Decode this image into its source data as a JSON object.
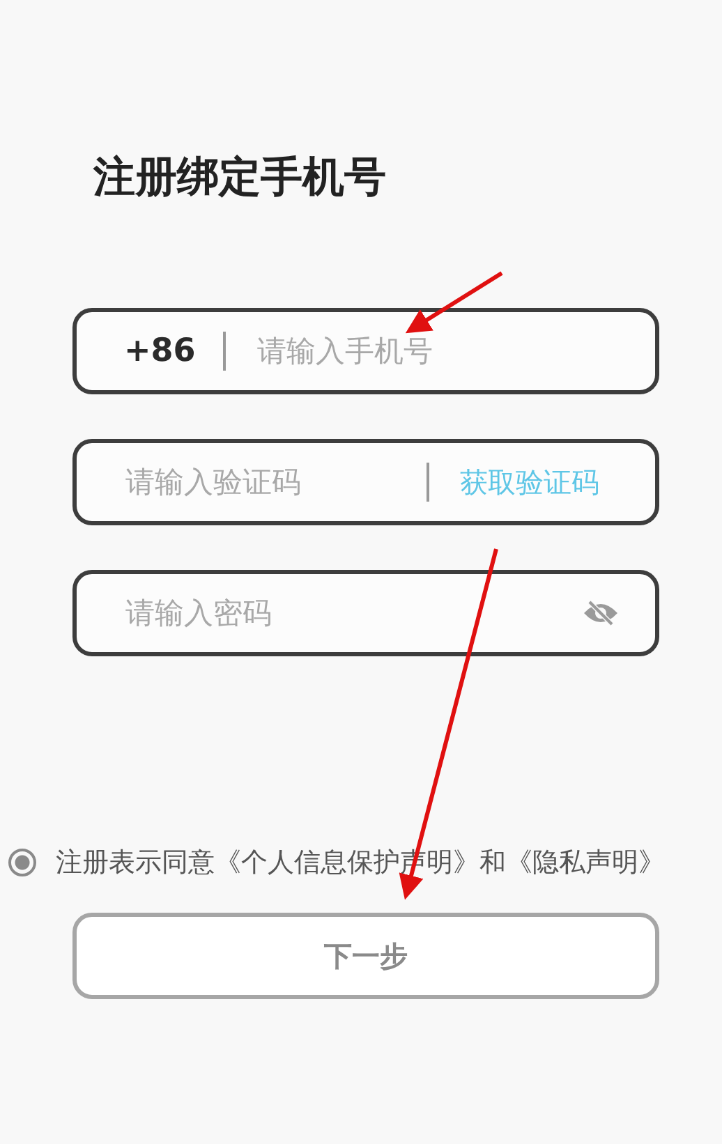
{
  "title": "注册绑定手机号",
  "fields": [
    {
      "kind": "phone",
      "prefix": "+86",
      "placeholder": "请输入手机号"
    },
    {
      "kind": "code",
      "placeholder": "请输入验证码",
      "action": "获取验证码"
    },
    {
      "kind": "password",
      "placeholder": "请输入密码"
    }
  ],
  "agreement": {
    "selected": true,
    "text": "注册表示同意《个人信息保护声明》和《隐私声明》"
  },
  "next_button": "下一步"
}
